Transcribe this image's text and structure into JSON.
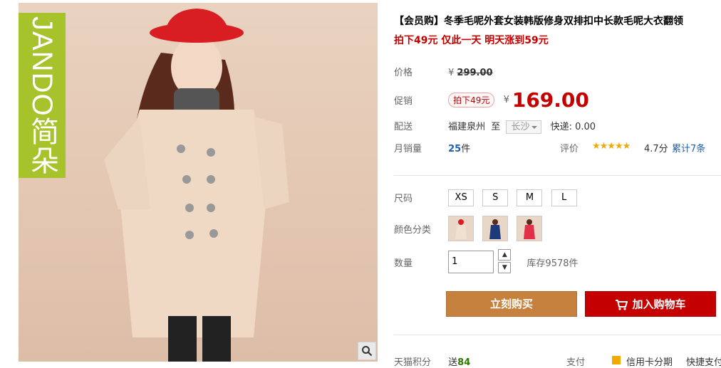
{
  "product_image": {
    "brand_text": "JANDO简朵",
    "zoom_icon": "magnifier-icon"
  },
  "info": {
    "title": "【会员购】冬季毛呢外套女装韩版修身双排扣中长款毛呢大衣翻领",
    "promo": "拍下49元 仅此一天 明天涨到59元",
    "price": {
      "label": "价格",
      "currency": "¥",
      "value": "299.00"
    },
    "sale": {
      "label": "促销",
      "tag": "拍下49元",
      "currency": "¥",
      "value": "169.00"
    },
    "shipping": {
      "label": "配送",
      "from": "福建泉州",
      "to_word": "至",
      "to_city": "长沙",
      "express": "快递: 0.00"
    },
    "monthly_sales": {
      "label": "月销量",
      "count": "25",
      "unit": "件"
    },
    "rating": {
      "label": "评价",
      "stars": "★★★★★",
      "score": "4.7分",
      "total": "累计7条"
    },
    "size": {
      "label": "尺码",
      "options": [
        "XS",
        "S",
        "M",
        "L"
      ]
    },
    "color": {
      "label": "颜色分类"
    },
    "quantity": {
      "label": "数量",
      "value": "1",
      "stock": "库存9578件"
    },
    "buy_now": "立刻购买",
    "add_to_cart": "加入购物车",
    "points": {
      "label": "天猫积分",
      "value_prefix": "送",
      "value": "84"
    },
    "payment": {
      "label": "支付",
      "credit": "信用卡分期",
      "quick": "快捷支付"
    }
  },
  "colors": {
    "accent_red": "#c40000",
    "buy_orange": "#c6813f",
    "brand_green": "#a6c32b"
  }
}
